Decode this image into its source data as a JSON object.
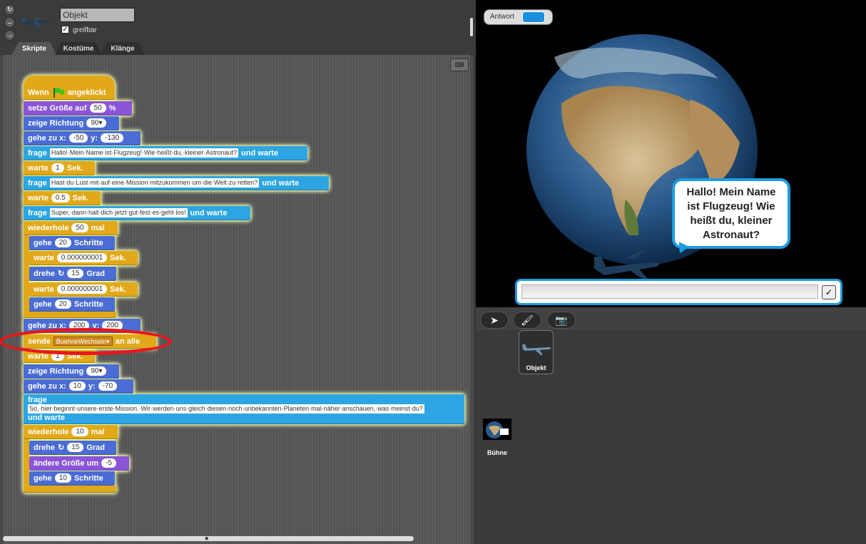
{
  "sprite_header": {
    "name": "Objekt",
    "draggable_label": "greifbar",
    "draggable_checked": "✓",
    "rotation_icons": [
      "↻",
      "↔",
      "→"
    ]
  },
  "tabs": [
    "Skripte",
    "Kostüme",
    "Klänge"
  ],
  "keyboard_icon": "keyboard-icon",
  "blocks": {
    "when_flag": {
      "pre": "Wenn",
      "post": "angeklickt"
    },
    "set_size": {
      "label": "setze Größe auf",
      "value": "50",
      "unit": "%"
    },
    "point_dir1": {
      "label": "zeige Richtung",
      "value": "90▾"
    },
    "goto1": {
      "label": "gehe zu x:",
      "x": "-50",
      "ylab": "y:",
      "y": "-130"
    },
    "ask1": {
      "label": "frage",
      "text": "Hallo!·Mein·Name·ist·Flugzeug!·Wie·heißt·du,·kleiner·Astronaut?",
      "post": "und warte"
    },
    "wait1": {
      "label": "warte",
      "value": "1",
      "unit": "Sek."
    },
    "ask2": {
      "label": "frage",
      "text": "Hast·du·Lust·mit·auf·eine·Mission·mitzukommen·um·die·Welt·zu·retten?",
      "post": "und warte"
    },
    "wait2": {
      "label": "warte",
      "value": "0.5",
      "unit": "Sek."
    },
    "ask3": {
      "label": "frage",
      "text": "Super,·dann·halt·dich·jetzt·gut·fest·es·geht·los!",
      "post": "und warte"
    },
    "repeat1": {
      "label": "wiederhole",
      "value": "50",
      "unit": "mal"
    },
    "move20a": {
      "label": "gehe",
      "value": "20",
      "unit": "Schritte"
    },
    "waitTiny1": {
      "label": "warte",
      "value": "0.000000001",
      "unit": "Sek."
    },
    "turn15a": {
      "label": "drehe",
      "icon": "↻",
      "value": "15",
      "unit": "Grad"
    },
    "waitTiny2": {
      "label": "warte",
      "value": "0.000000001",
      "unit": "Sek."
    },
    "move20b": {
      "label": "gehe",
      "value": "20",
      "unit": "Schritte"
    },
    "goto2": {
      "label": "gehe zu x:",
      "x": "200",
      "ylab": "y:",
      "y": "200"
    },
    "broadcast": {
      "label": "sende",
      "msg": "BuehneWechseln▾",
      "post": "an alle"
    },
    "wait3": {
      "label": "warte",
      "value": "1",
      "unit": "Sek."
    },
    "point_dir2": {
      "label": "zeige Richtung",
      "value": "90▾"
    },
    "goto3": {
      "label": "gehe zu x:",
      "x": "10",
      "ylab": "y:",
      "y": "-70"
    },
    "ask4": {
      "label": "frage",
      "text": "So,·hier·beginnt·unsere·erste·Mission.·Wir·werden·uns·gleich·diesen·noch·unbekannten·Planeten·mal·näher·anschauen,·was·meinst·du?",
      "post": "und warte"
    },
    "repeat2": {
      "label": "wiederhole",
      "value": "10",
      "unit": "mal"
    },
    "turn15b": {
      "label": "drehe",
      "icon": "↻",
      "value": "15",
      "unit": "Grad"
    },
    "change_size": {
      "label": "ändere Größe um",
      "value": "-5"
    },
    "move10": {
      "label": "gehe",
      "value": "10",
      "unit": "Schritte"
    }
  },
  "stage": {
    "answer_label": "Antwort",
    "bubble_text": "Hallo! Mein Name ist Flugzeug! Wie heißt du, kleiner Astronaut?",
    "ask_ok": "✓"
  },
  "sprite_corral": {
    "tools": [
      "➤",
      "🖌",
      "📷"
    ],
    "sprite_label": "Objekt",
    "stage_label": "Bühne"
  },
  "colors": {
    "control": "#e1a91a",
    "looks": "#8a55d7",
    "motion": "#4a6cd4",
    "sensing": "#2ca5e2",
    "highlight": "#e8161c"
  }
}
